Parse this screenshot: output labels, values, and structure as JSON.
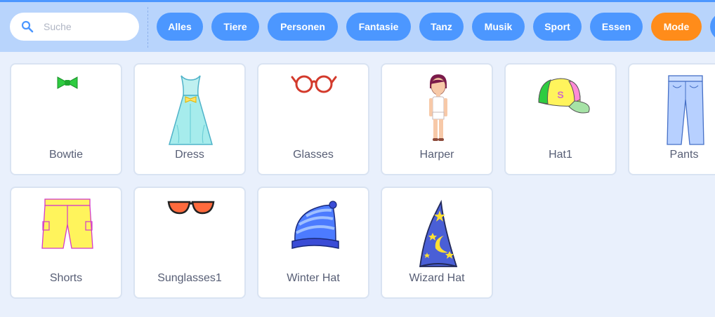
{
  "search": {
    "placeholder": "Suche",
    "icon": "search-icon"
  },
  "tags": [
    {
      "label": "Alles",
      "active": false
    },
    {
      "label": "Tiere",
      "active": false
    },
    {
      "label": "Personen",
      "active": false
    },
    {
      "label": "Fantasie",
      "active": false
    },
    {
      "label": "Tanz",
      "active": false
    },
    {
      "label": "Musik",
      "active": false
    },
    {
      "label": "Sport",
      "active": false
    },
    {
      "label": "Essen",
      "active": false
    },
    {
      "label": "Mode",
      "active": true
    }
  ],
  "items": [
    {
      "name": "Bowtie",
      "icon": "bowtie-icon"
    },
    {
      "name": "Dress",
      "icon": "dress-icon"
    },
    {
      "name": "Glasses",
      "icon": "glasses-icon"
    },
    {
      "name": "Harper",
      "icon": "harper-icon"
    },
    {
      "name": "Hat1",
      "icon": "cap-icon"
    },
    {
      "name": "Pants",
      "icon": "pants-icon"
    },
    {
      "name": "Shorts",
      "icon": "shorts-icon"
    },
    {
      "name": "Sunglasses1",
      "icon": "sunglasses-icon"
    },
    {
      "name": "Winter Hat",
      "icon": "winter-hat-icon"
    },
    {
      "name": "Wizard Hat",
      "icon": "wizard-hat-icon"
    }
  ],
  "colors": {
    "accent": "#4c97ff",
    "active_tag": "#ff8c1a",
    "header": "#b8d4fc",
    "background": "#e9f0fc"
  }
}
